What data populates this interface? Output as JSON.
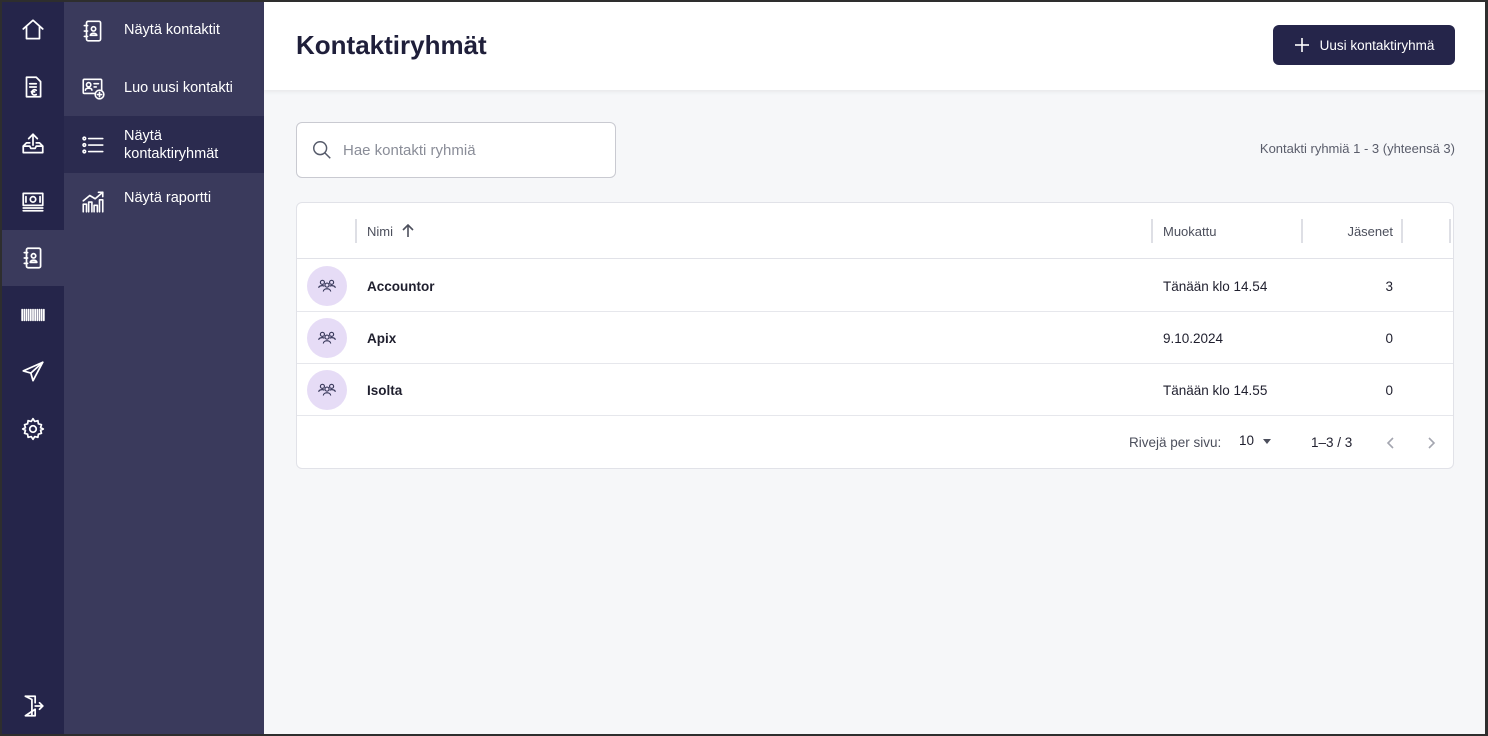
{
  "rail": {
    "items": [
      {
        "icon": "home-icon"
      },
      {
        "icon": "invoice-icon"
      },
      {
        "icon": "upload-tray-icon"
      },
      {
        "icon": "money-icon"
      },
      {
        "icon": "contact-book-icon",
        "active": true
      },
      {
        "icon": "barcode-icon"
      },
      {
        "icon": "send-icon"
      },
      {
        "icon": "gear-icon"
      }
    ],
    "logout_icon": "logout-icon"
  },
  "subnav": {
    "items": [
      {
        "label": "Näytä kontaktit",
        "icon": "contact-book-icon"
      },
      {
        "label": "Luo uusi kontakti",
        "icon": "add-contact-icon"
      },
      {
        "label": "Näytä kontaktiryhmät",
        "icon": "list-icon",
        "active": true
      },
      {
        "label": "Näytä raportti",
        "icon": "report-chart-icon"
      }
    ]
  },
  "header": {
    "title": "Kontaktiryhmät",
    "new_button_label": "Uusi kontaktiryhmä"
  },
  "search": {
    "placeholder": "Hae kontakti ryhmiä",
    "value": ""
  },
  "count_text": "Kontakti ryhmiä 1 - 3 (yhteensä 3)",
  "table": {
    "columns": {
      "name": "Nimi",
      "modified": "Muokattu",
      "members": "Jäsenet"
    },
    "rows": [
      {
        "name": "Accountor",
        "modified": "Tänään klo 14.54",
        "members": "3"
      },
      {
        "name": "Apix",
        "modified": "9.10.2024",
        "members": "0"
      },
      {
        "name": "Isolta",
        "modified": "Tänään klo 14.55",
        "members": "0"
      }
    ]
  },
  "pagination": {
    "rows_per_page_label": "Rivejä per sivu:",
    "rows_per_page_value": "10",
    "range": "1–3 / 3"
  },
  "colors": {
    "rail_bg": "#25254a",
    "subnav_bg": "#3a3a5c",
    "accent": "#25254a",
    "avatar_bg": "#e6dcf6"
  }
}
